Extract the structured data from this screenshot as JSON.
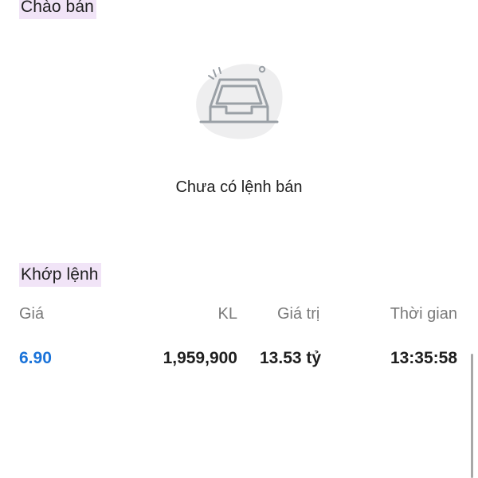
{
  "sell_offers": {
    "title": "Chào bán",
    "empty_icon": "empty-inbox-icon",
    "empty_message": "Chưa có lệnh bán"
  },
  "matched_orders": {
    "title": "Khớp lệnh",
    "columns": {
      "price": "Giá",
      "volume": "KL",
      "value": "Giá trị",
      "time": "Thời gian"
    },
    "rows": [
      {
        "price": "6.90",
        "volume": "1,959,900",
        "value": "13.53 tỷ",
        "time": "13:35:58"
      }
    ]
  },
  "colors": {
    "section_highlight": "#f1e4f7",
    "price_blue": "#1a73d9",
    "header_gray": "#7a7a7a",
    "icon_gray": "#9aa0a6",
    "icon_bg": "#eeeeef"
  }
}
